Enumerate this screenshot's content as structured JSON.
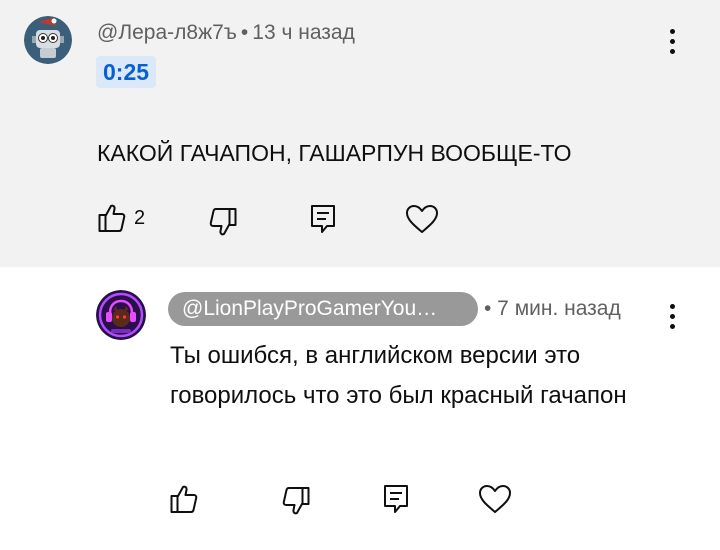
{
  "parent_comment": {
    "author": "@Лера-л8ж7ъ",
    "separator": "•",
    "time_ago": "13 ч назад",
    "timestamp_link": "0:25",
    "text": "КАКОЙ ГАЧАПОН, ГАШАРПУН ВООБЩЕ-ТО",
    "like_count": "2",
    "icons": [
      "thumbs-up-icon",
      "thumbs-down-icon",
      "reply-icon",
      "heart-icon",
      "more-vert-icon"
    ]
  },
  "reply": {
    "author": "@LionPlayProGamerYou…",
    "time_ago": "• 7 мин. назад",
    "text": "Ты ошибся, в английском версии это говорилось что это был красный гачапон",
    "icons": [
      "thumbs-up-icon",
      "thumbs-down-icon",
      "reply-icon",
      "heart-icon",
      "more-vert-icon"
    ]
  },
  "colors": {
    "parent_background": "#f2f2f2",
    "timestamp_link": "#065fd4",
    "author_chip": "#999999",
    "secondary_text": "#606060"
  }
}
